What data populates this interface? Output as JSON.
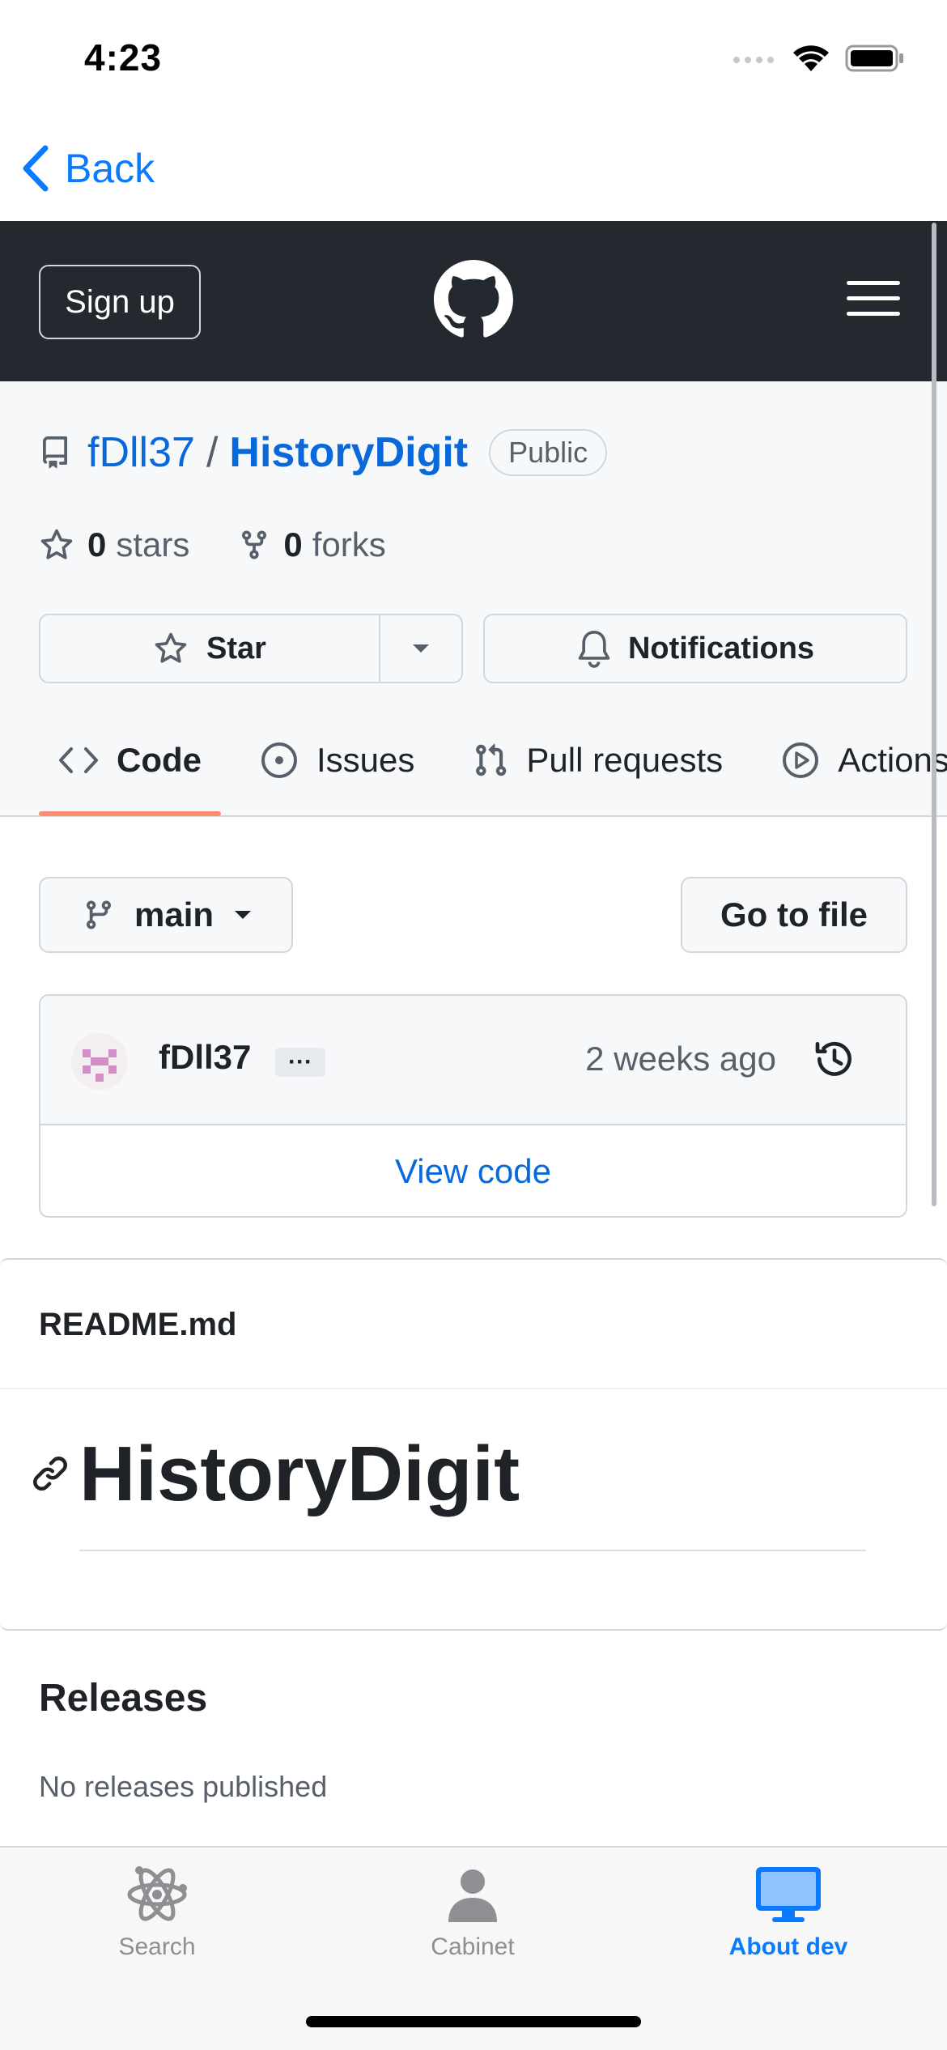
{
  "status_bar": {
    "time": "4:23"
  },
  "nav": {
    "back_label": "Back"
  },
  "header": {
    "signup_label": "Sign up"
  },
  "repo": {
    "owner": "fDll37",
    "separator": "/",
    "name": "HistoryDigit",
    "visibility": "Public",
    "stars_count": "0",
    "stars_label": "stars",
    "forks_count": "0",
    "forks_label": "forks",
    "star_button": "Star",
    "notifications_button": "Notifications"
  },
  "tabs": [
    {
      "label": "Code",
      "icon": "code-icon",
      "active": true
    },
    {
      "label": "Issues",
      "icon": "issue-icon",
      "active": false
    },
    {
      "label": "Pull requests",
      "icon": "pull-request-icon",
      "active": false
    },
    {
      "label": "Actions",
      "icon": "play-icon",
      "active": false
    }
  ],
  "branch": {
    "name": "main",
    "goto_file_label": "Go to file"
  },
  "commit": {
    "author": "fDll37",
    "dots": "···",
    "time": "2 weeks ago",
    "view_code_label": "View code"
  },
  "readme": {
    "filename": "README.md",
    "heading": "HistoryDigit"
  },
  "releases": {
    "title": "Releases",
    "text": "No releases published"
  },
  "tab_bar": {
    "items": [
      {
        "label": "Search",
        "icon": "atom-icon",
        "active": false
      },
      {
        "label": "Cabinet",
        "icon": "person-icon",
        "active": false
      },
      {
        "label": "About dev",
        "icon": "desktop-icon",
        "active": true
      }
    ]
  },
  "colors": {
    "link": "#0969da",
    "ios_blue": "#0a7aff",
    "header_bg": "#24292f",
    "tab_underline": "#fd8c73"
  }
}
